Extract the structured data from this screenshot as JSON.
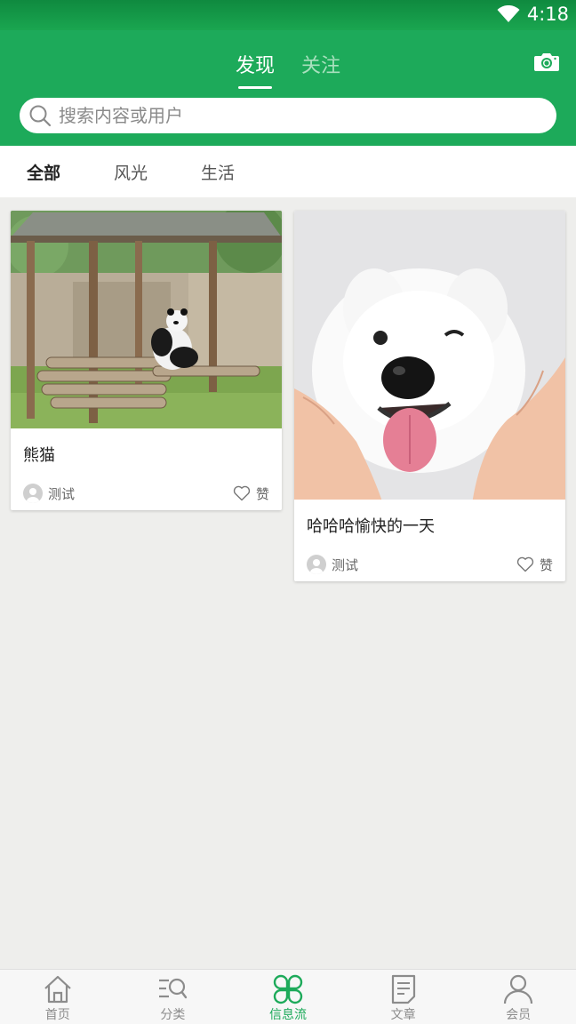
{
  "status_bar": {
    "time": "4:18"
  },
  "header": {
    "tabs": [
      {
        "label": "发现",
        "active": true
      },
      {
        "label": "关注",
        "active": false
      }
    ],
    "camera_icon": "camera-icon"
  },
  "search": {
    "placeholder": "搜索内容或用户",
    "value": ""
  },
  "categories": [
    {
      "label": "全部",
      "active": true
    },
    {
      "label": "风光",
      "active": false
    },
    {
      "label": "生活",
      "active": false
    }
  ],
  "posts": [
    {
      "title": "熊猫",
      "author": "测试",
      "like_label": "赞",
      "image": "panda-photo"
    },
    {
      "title": "哈哈哈愉快的一天",
      "author": "测试",
      "like_label": "赞",
      "image": "samoyed-photo"
    }
  ],
  "bottom_nav": [
    {
      "label": "首页",
      "icon": "home-icon",
      "active": false
    },
    {
      "label": "分类",
      "icon": "category-icon",
      "active": false
    },
    {
      "label": "信息流",
      "icon": "feed-icon",
      "active": true
    },
    {
      "label": "文章",
      "icon": "article-icon",
      "active": false
    },
    {
      "label": "会员",
      "icon": "member-icon",
      "active": false
    }
  ],
  "colors": {
    "brand": "#1daa5a",
    "status_bar": "#0f8a3f",
    "background": "#eeeeec"
  }
}
